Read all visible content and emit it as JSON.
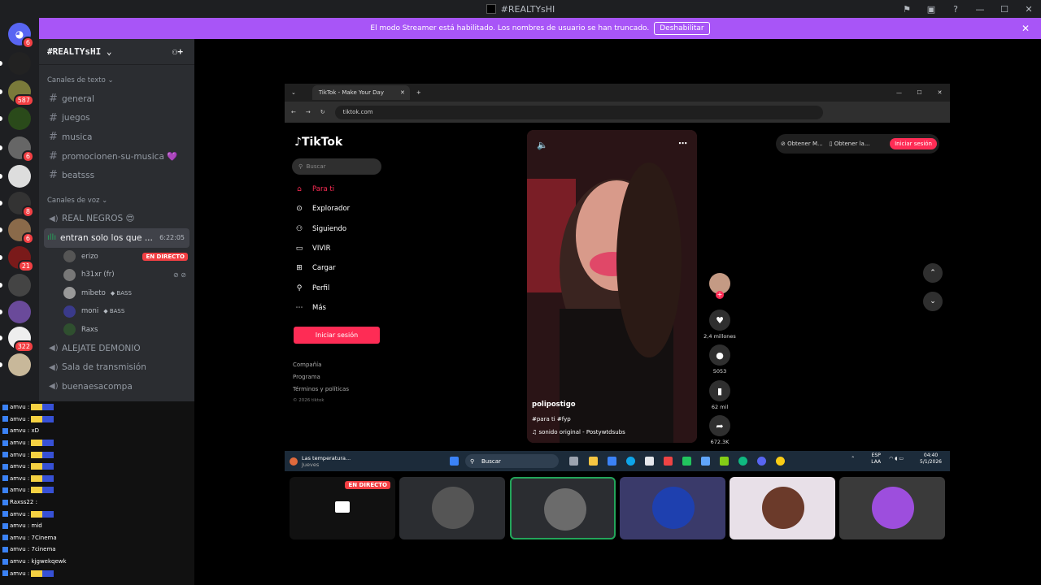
{
  "window": {
    "title": "#REALTYsHI"
  },
  "banner": {
    "text": "El modo Streamer está habilitado. Los nombres de usuario se han truncado.",
    "button": "Deshabilitar"
  },
  "servers": [
    {
      "badge": "6",
      "color": "#5865f2"
    },
    {
      "badge": "",
      "color": "#222"
    },
    {
      "badge": "587",
      "color": "#7a7a3a"
    },
    {
      "badge": "",
      "color": "#2a4a1a"
    },
    {
      "badge": "6",
      "color": "#666"
    },
    {
      "badge": "",
      "color": "#ddd"
    },
    {
      "badge": "8",
      "color": "#333"
    },
    {
      "badge": "6",
      "color": "#8a6a4a"
    },
    {
      "badge": "21",
      "color": "#7a1a1a"
    },
    {
      "badge": "",
      "color": "#444"
    },
    {
      "badge": "",
      "color": "#6a4a9a"
    },
    {
      "badge": "322",
      "color": "#eee"
    },
    {
      "badge": "",
      "color": "#c8b89a"
    }
  ],
  "guild": {
    "name": "#REALTYsHI"
  },
  "sidebar": {
    "text_category": "Canales de texto",
    "text_channels": [
      "general",
      "juegos",
      "musica",
      "promocionen-su-musica 💜",
      "beatsss"
    ],
    "voice_category": "Canales de voz",
    "voice_before": [
      "REAL NEGROS 😍"
    ],
    "active_channel": {
      "name": "entran solo los que ...",
      "time": "6:22:05"
    },
    "voice_users": [
      {
        "name": "erizo",
        "tag": "",
        "live": "EN DIRECTO",
        "muted": ""
      },
      {
        "name": "h31xr (fr)",
        "tag": "",
        "live": "",
        "muted": "⊘ ⊘"
      },
      {
        "name": "mibeto",
        "tag": "BASS",
        "live": "",
        "muted": ""
      },
      {
        "name": "moni",
        "tag": "BASS",
        "live": "",
        "muted": ""
      },
      {
        "name": "Raxs",
        "tag": "",
        "live": "",
        "muted": ""
      }
    ],
    "voice_after": [
      "ALEJATE DEMONIO",
      "Sala de transmisión",
      "buenaesacompa"
    ]
  },
  "chat": [
    {
      "text": "amvu :",
      "emote": true
    },
    {
      "text": "amvu :",
      "emote": true
    },
    {
      "text": "amvu : xD",
      "emote": false
    },
    {
      "text": "amvu :",
      "emote": true
    },
    {
      "text": "amvu :",
      "emote": true
    },
    {
      "text": "amvu :",
      "emote": true
    },
    {
      "text": "amvu :",
      "emote": true
    },
    {
      "text": "amvu :",
      "emote": true
    },
    {
      "text": "Raxss22 :",
      "emote": false
    },
    {
      "text": "amvu :",
      "emote": true
    },
    {
      "text": "amvu : mid",
      "emote": false
    },
    {
      "text": "amvu : 7Cinema",
      "emote": false
    },
    {
      "text": "amvu : 7cinema",
      "emote": false
    },
    {
      "text": "amvu : kjgwekqewk",
      "emote": false
    },
    {
      "text": "amvu :",
      "emote": true
    }
  ],
  "browser": {
    "tab": "TikTok - Make Your Day",
    "url": "tiktok.com"
  },
  "tiktok": {
    "logo": "TikTok",
    "search_placeholder": "Buscar",
    "nav": [
      {
        "label": "Para ti",
        "icon": "⌂"
      },
      {
        "label": "Explorador",
        "icon": "⊙"
      },
      {
        "label": "Siguiendo",
        "icon": "⚇"
      },
      {
        "label": "VIVIR",
        "icon": "▭"
      },
      {
        "label": "Cargar",
        "icon": "⊞"
      },
      {
        "label": "Perfil",
        "icon": "⚲"
      },
      {
        "label": "Más",
        "icon": "⋯"
      }
    ],
    "login": "Iniciar sesión",
    "footer": [
      "Compañía",
      "Programa",
      "Términos y políticas",
      "© 2026 tiktok"
    ],
    "topbar": {
      "btn1": "Obtener M...",
      "btn2": "Obtener la...",
      "login": "Iniciar sesión"
    },
    "video": {
      "author": "polipostigo",
      "tags": "#para ti #fyp",
      "sound": "♫  sonido original - Postywtdsubs"
    },
    "actions": [
      {
        "icon": "♥",
        "count": "2,4 millones"
      },
      {
        "icon": "●",
        "count": "5053"
      },
      {
        "icon": "▮",
        "count": "62 mil"
      },
      {
        "icon": "➦",
        "count": "672.3K"
      }
    ]
  },
  "taskbar": {
    "weather_title": "Las temperatura...",
    "weather_sub": "Jueves",
    "search": "Buscar",
    "lang": "ESP",
    "lang2": "LAA",
    "time": "04:40",
    "date": "5/1/2026"
  },
  "tiles": [
    {
      "live": "EN DIRECTO"
    },
    {
      "live": ""
    },
    {
      "live": ""
    },
    {
      "live": ""
    },
    {
      "live": ""
    },
    {
      "live": ""
    }
  ],
  "colors": {
    "discord_bg": "#2b2d31",
    "streamer_banner": "#a855f7",
    "tiktok_red": "#fe2c55",
    "live_red": "#f23f43"
  }
}
